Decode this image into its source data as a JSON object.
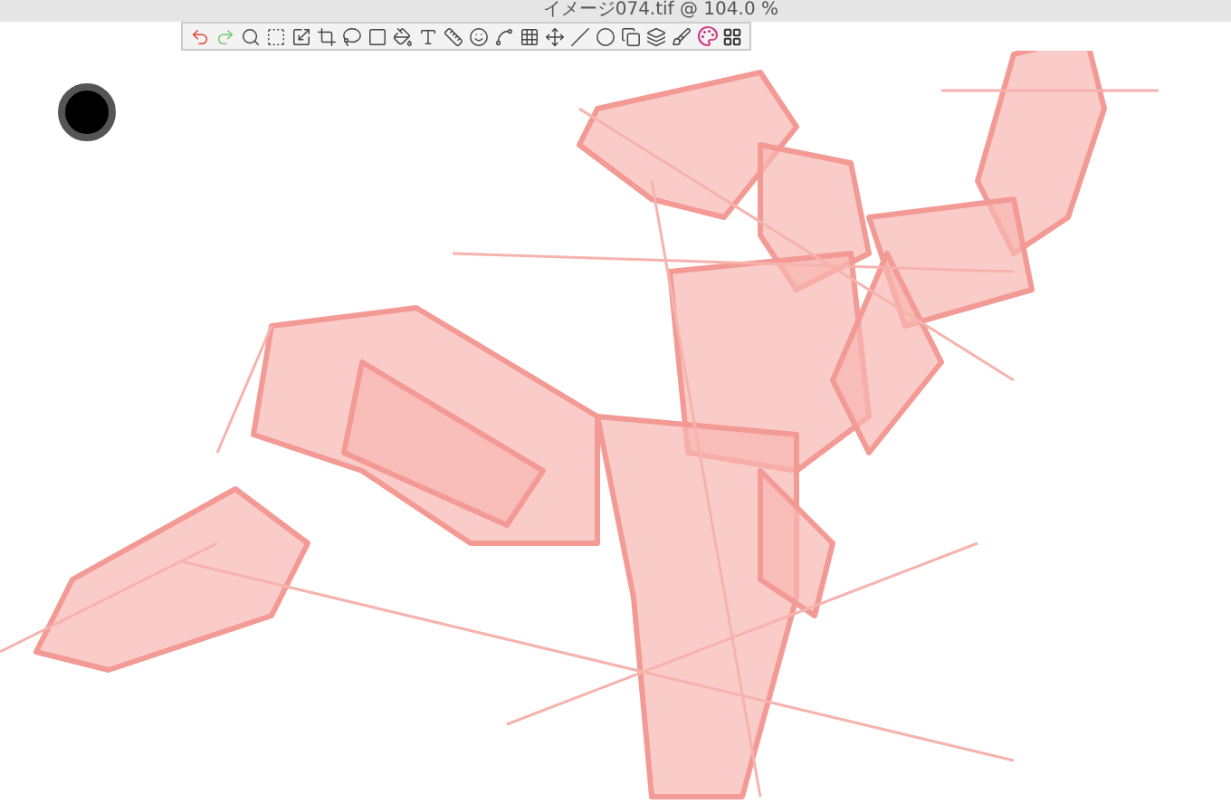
{
  "window": {
    "title": "イメージ074.tif @ 104.0 %"
  }
}
